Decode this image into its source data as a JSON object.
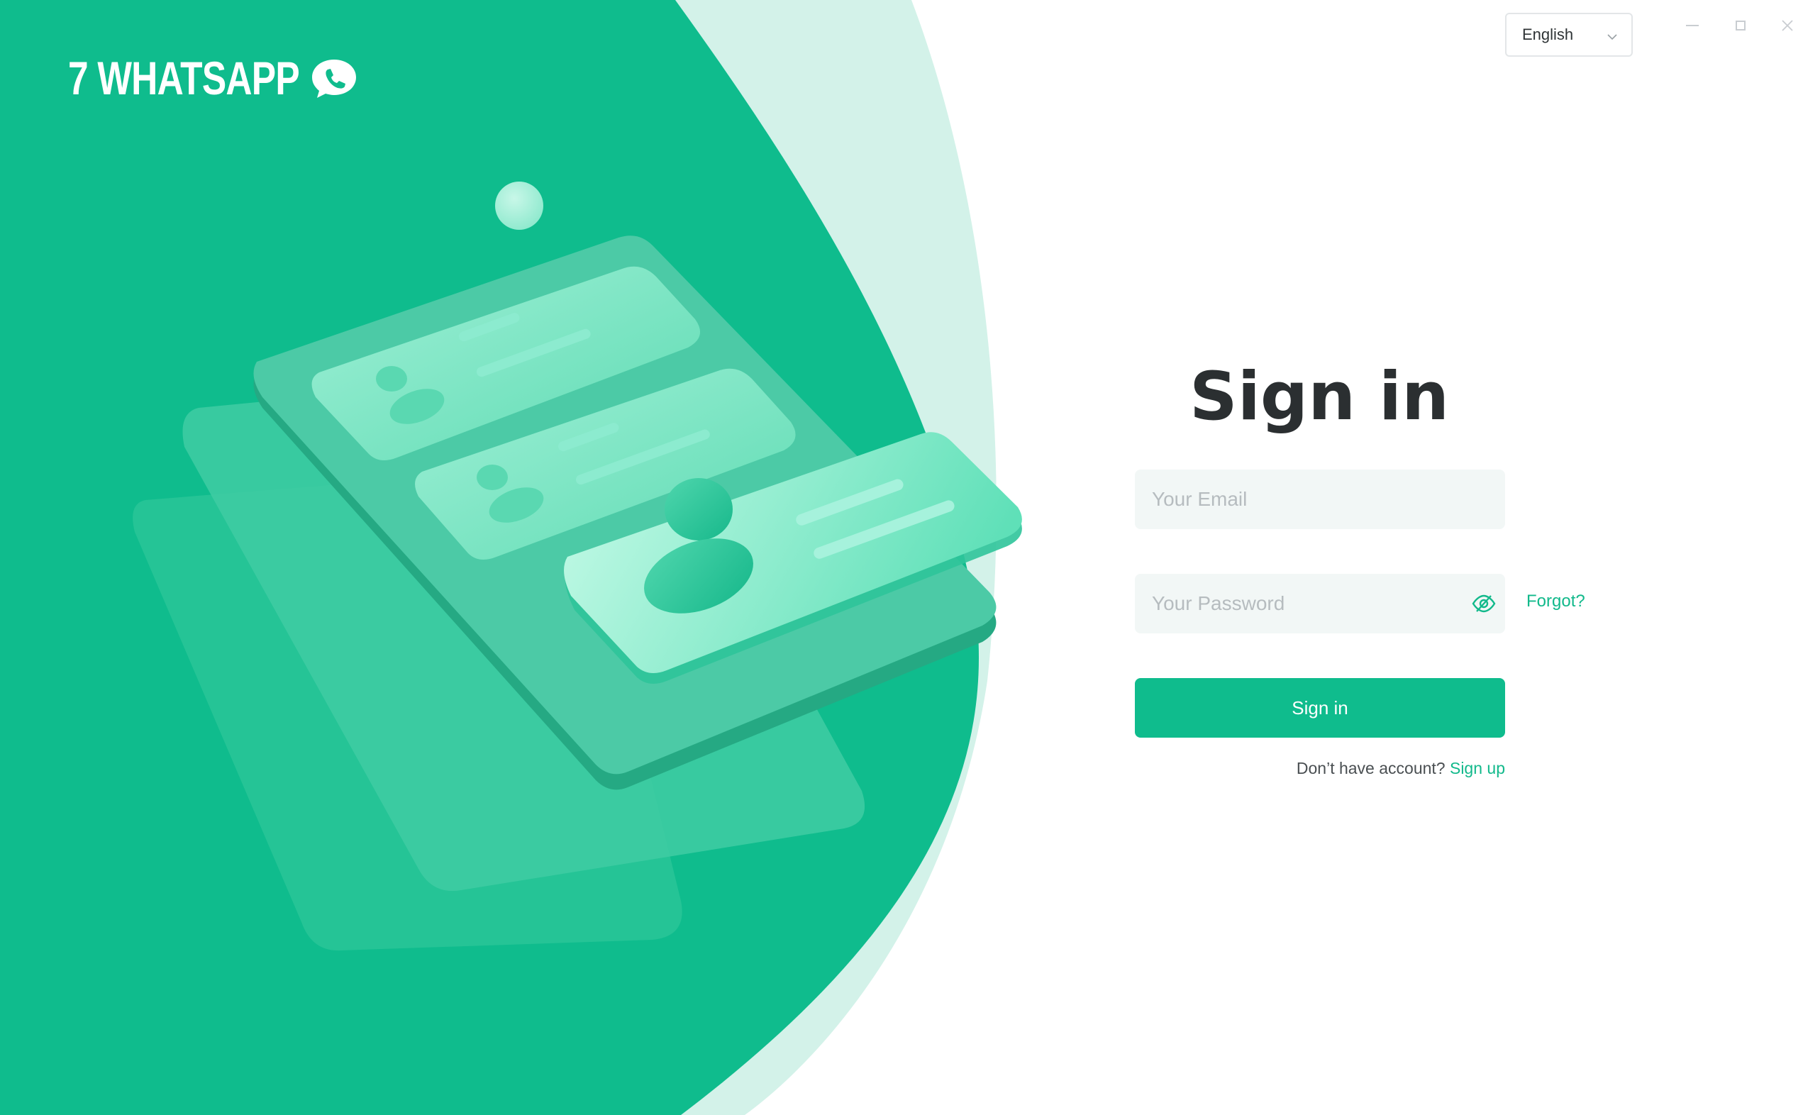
{
  "brand": {
    "name": "7 WHATSAPP"
  },
  "window": {
    "minimize": "minimize",
    "maximize": "maximize",
    "close": "close"
  },
  "language": {
    "selected": "English"
  },
  "form": {
    "title": "Sign in",
    "email_placeholder": "Your Email",
    "password_placeholder": "Your Password",
    "forgot_label": "Forgot?",
    "submit_label": "Sign in",
    "signup_prompt": "Don’t have account?",
    "signup_link": "Sign up"
  },
  "colors": {
    "brand_green": "#0fbc8d",
    "light_green": "#d3f2e9",
    "link_green": "#12b98b",
    "title": "#2b2f31",
    "input_bg": "#f2f7f6"
  },
  "icons": {
    "brand": "phone-chat-icon",
    "language_caret": "chevron-down-icon",
    "password_toggle": "eye-off-icon"
  }
}
